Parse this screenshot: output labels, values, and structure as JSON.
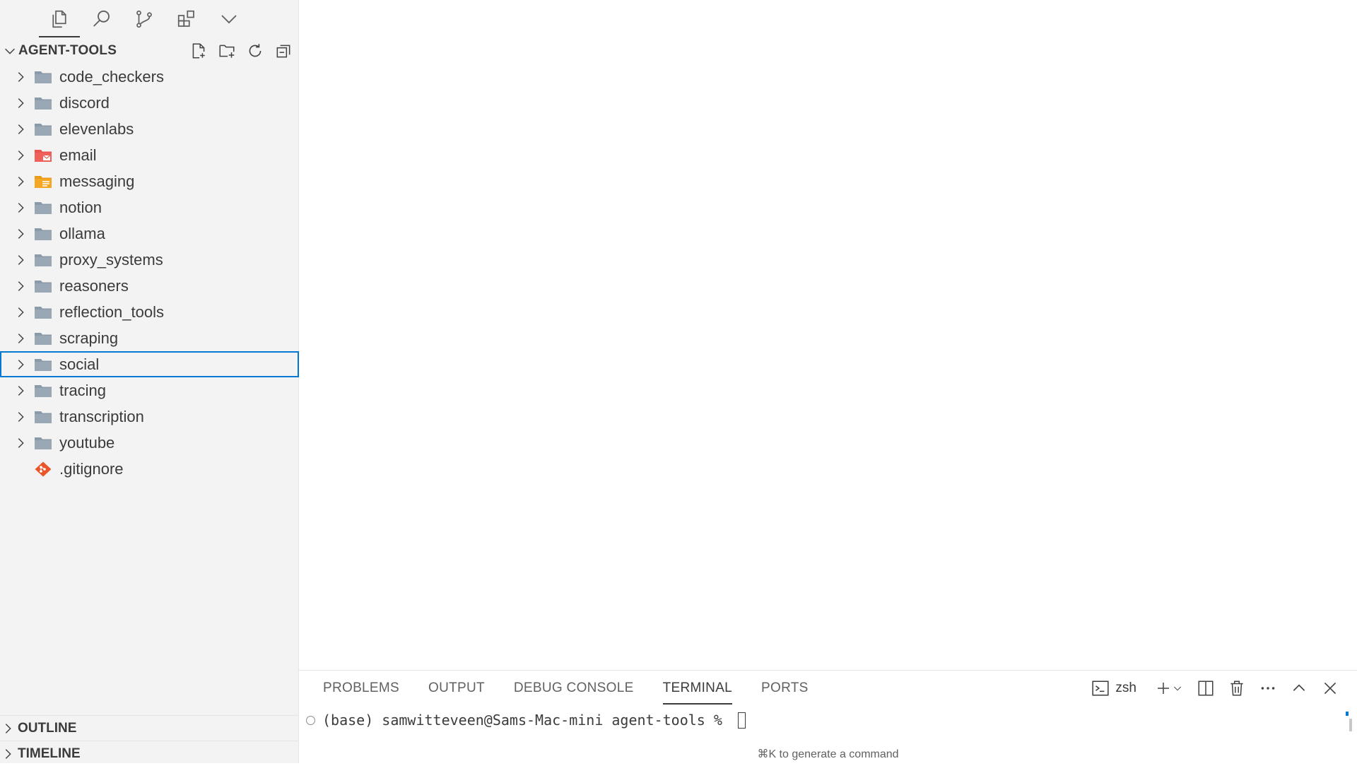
{
  "activity_bar": {
    "items": [
      {
        "name": "explorer",
        "icon": "files-icon"
      },
      {
        "name": "search",
        "icon": "search-icon"
      },
      {
        "name": "source-control",
        "icon": "source-control-icon"
      },
      {
        "name": "extensions",
        "icon": "extensions-icon"
      },
      {
        "name": "more",
        "icon": "chevron-down-icon"
      }
    ]
  },
  "explorer": {
    "title": "AGENT-TOOLS",
    "actions": [
      "new-file-icon",
      "new-folder-icon",
      "refresh-icon",
      "collapse-all-icon"
    ],
    "items": [
      {
        "label": "code_checkers",
        "type": "folder"
      },
      {
        "label": "discord",
        "type": "folder"
      },
      {
        "label": "elevenlabs",
        "type": "folder"
      },
      {
        "label": "email",
        "type": "folder-email"
      },
      {
        "label": "messaging",
        "type": "folder-messaging"
      },
      {
        "label": "notion",
        "type": "folder"
      },
      {
        "label": "ollama",
        "type": "folder"
      },
      {
        "label": "proxy_systems",
        "type": "folder"
      },
      {
        "label": "reasoners",
        "type": "folder"
      },
      {
        "label": "reflection_tools",
        "type": "folder"
      },
      {
        "label": "scraping",
        "type": "folder"
      },
      {
        "label": "social",
        "type": "folder",
        "selected": true
      },
      {
        "label": "tracing",
        "type": "folder"
      },
      {
        "label": "transcription",
        "type": "folder"
      },
      {
        "label": "youtube",
        "type": "folder"
      },
      {
        "label": ".gitignore",
        "type": "git-file"
      }
    ]
  },
  "outline": {
    "title": "OUTLINE"
  },
  "timeline": {
    "title": "TIMELINE"
  },
  "panel": {
    "tabs": [
      {
        "label": "PROBLEMS"
      },
      {
        "label": "OUTPUT"
      },
      {
        "label": "DEBUG CONSOLE"
      },
      {
        "label": "TERMINAL",
        "active": true
      },
      {
        "label": "PORTS"
      }
    ],
    "terminal_name": "zsh",
    "prompt": "(base) samwitteveen@Sams-Mac-mini agent-tools % ",
    "hint": "⌘K to generate a command"
  },
  "colors": {
    "sidebar_bg": "#f3f3f3",
    "folder": "#8a9aa8",
    "email_folder": "#f0605a",
    "messaging_folder": "#f5a623",
    "git": "#e8562a",
    "focus": "#0078d4"
  }
}
